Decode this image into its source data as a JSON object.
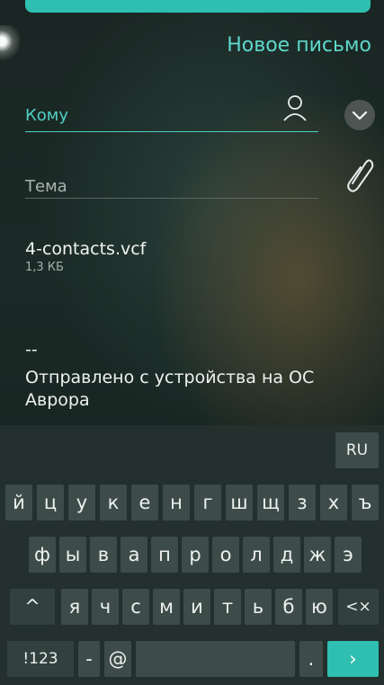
{
  "header": {
    "title": "Новое письмо"
  },
  "to_field": {
    "label": "Кому"
  },
  "subject_field": {
    "label": "Тема"
  },
  "attachment": {
    "name": "4-contacts.vcf",
    "size": "1,3 КБ"
  },
  "signature": {
    "dash": "--",
    "text": "Отправлено с устройства на ОС Аврора"
  },
  "keyboard": {
    "language": "RU",
    "row1": [
      "й",
      "ц",
      "у",
      "к",
      "е",
      "н",
      "г",
      "ш",
      "щ",
      "з",
      "х",
      "ъ"
    ],
    "row2": [
      "ф",
      "ы",
      "в",
      "а",
      "п",
      "р",
      "о",
      "л",
      "д",
      "ж",
      "э"
    ],
    "shift": "^",
    "row3": [
      "я",
      "ч",
      "с",
      "м",
      "и",
      "т",
      "ь",
      "б",
      "ю"
    ],
    "backspace": "<×",
    "symbols": "!123",
    "dash": "-",
    "at": "@",
    "space": "",
    "dot": ".",
    "enter": "›"
  },
  "colors": {
    "accent": "#2fbfb1",
    "key": "#3e4c49",
    "keyboard_bg": "#23302d"
  }
}
